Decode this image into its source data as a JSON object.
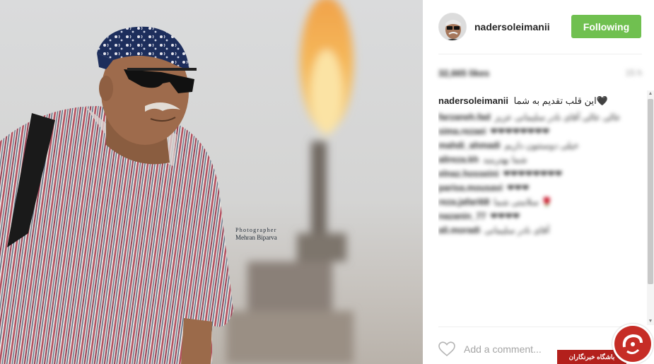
{
  "photo": {
    "credit_line1": "Photographer",
    "credit_line2": "Mehran Biparva"
  },
  "header": {
    "username": "nadersoleimanii",
    "follow_label": "Following"
  },
  "stats": {
    "likes": "32,665 likes",
    "time": "15 h"
  },
  "caption": {
    "username": "nadersoleimanii",
    "text": "این قلب تقدیم به شما🖤"
  },
  "comments": [
    {
      "user": "farzaneh.fad",
      "text": "عالی عالی آقای نادر سلیمانی عزیز"
    },
    {
      "user": "sima.rezaei",
      "text": "❤❤❤❤❤❤❤❤"
    },
    {
      "user": "mahdi_ahmadi",
      "text": "خیلی دوستتون داریم"
    },
    {
      "user": "alireza.kh",
      "text": "شما بهترینید"
    },
    {
      "user": "elnaz.hosseini",
      "text": "❤❤❤❤❤❤❤❤"
    },
    {
      "user": "parisa.mousavi",
      "text": "❤❤❤"
    },
    {
      "user": "reza.jafari68",
      "text": "سلامتی شما 🌹"
    },
    {
      "user": "nazanin_77",
      "text": "❤❤❤❤"
    },
    {
      "user": "ali.moradi",
      "text": "آقای نادر سلیمانی"
    }
  ],
  "footer": {
    "comment_placeholder": "Add a comment..."
  },
  "watermark": {
    "text": "باشگاه خبرنگاران"
  },
  "colors": {
    "follow_green": "#70c050",
    "watermark_red": "#b3201c"
  },
  "icons": {
    "heart": "heart-outline-icon"
  }
}
